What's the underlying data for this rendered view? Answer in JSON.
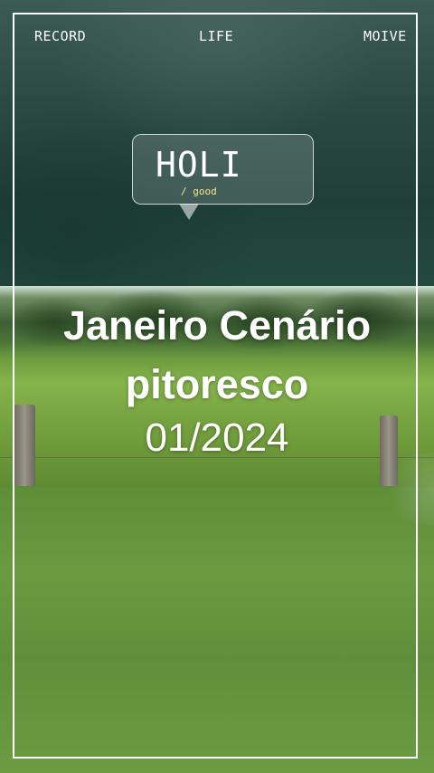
{
  "nav": {
    "left_label": "RECORD",
    "center_label": "LIFE",
    "right_label": "MOIVE"
  },
  "bubble": {
    "title": "HOLI",
    "subtitle": "/ good"
  },
  "headline": {
    "line1": "Janeiro Cenário",
    "line2": "pitoresco",
    "date": "01/2024"
  },
  "colors": {
    "frame": "#ffffff",
    "subtitle": "#f1e88c",
    "top_background": "#2a4a43",
    "grass": "#6f9b3b"
  }
}
